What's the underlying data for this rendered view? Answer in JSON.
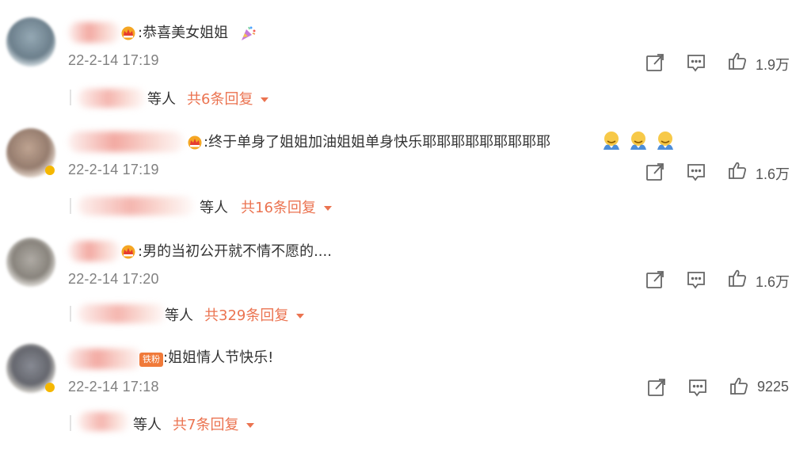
{
  "comments": [
    {
      "text": ":恭喜美女姐姐",
      "time": "22-2-14 17:19",
      "likes": "1.9万",
      "reply_suffix": "等人",
      "reply_count": "共6条回复",
      "badge": ""
    },
    {
      "text": ":终于单身了姐姐加油姐姐单身快乐耶耶耶耶耶耶耶耶耶",
      "time": "22-2-14 17:19",
      "likes": "1.6万",
      "reply_suffix": "等人",
      "reply_count": "共16条回复",
      "badge": ""
    },
    {
      "text": ":男的当初公开就不情不愿的....",
      "time": "22-2-14 17:20",
      "likes": "1.6万",
      "reply_suffix": "等人",
      "reply_count": "共329条回复",
      "badge": ""
    },
    {
      "text": ":姐姐情人节快乐!",
      "time": "22-2-14 17:18",
      "likes": "9225",
      "reply_suffix": "等人",
      "reply_count": "共7条回复",
      "badge": "铁粉"
    }
  ],
  "colors": {
    "accent": "#eb7350",
    "time": "#808080",
    "text": "#333333",
    "icon": "#666666"
  },
  "icons": {
    "share": "share-icon",
    "comment": "comment-icon",
    "like": "like-icon",
    "dropdown": "caret-down-icon",
    "crown": "vip-crown-icon",
    "emoji": "hug-emoji-icon"
  }
}
